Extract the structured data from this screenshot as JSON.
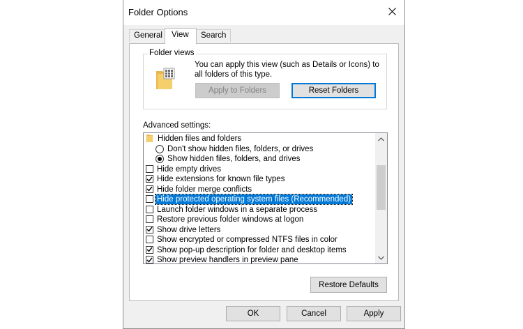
{
  "window": {
    "title": "Folder Options"
  },
  "tabs": [
    {
      "label": "General",
      "active": false
    },
    {
      "label": "View",
      "active": true
    },
    {
      "label": "Search",
      "active": false
    }
  ],
  "folder_views": {
    "legend": "Folder views",
    "description": "You can apply this view (such as Details or Icons) to all folders of this type.",
    "apply_button": "Apply to Folders",
    "reset_button": "Reset Folders"
  },
  "advanced": {
    "label": "Advanced settings:",
    "items": [
      {
        "type": "folder",
        "label": "Hidden files and folders"
      },
      {
        "type": "radio",
        "checked": false,
        "label": "Don't show hidden files, folders, or drives"
      },
      {
        "type": "radio",
        "checked": true,
        "label": "Show hidden files, folders, and drives"
      },
      {
        "type": "checkbox",
        "checked": false,
        "label": "Hide empty drives"
      },
      {
        "type": "checkbox",
        "checked": true,
        "label": "Hide extensions for known file types"
      },
      {
        "type": "checkbox",
        "checked": true,
        "label": "Hide folder merge conflicts"
      },
      {
        "type": "checkbox",
        "checked": false,
        "selected": true,
        "label": "Hide protected operating system files (Recommended)"
      },
      {
        "type": "checkbox",
        "checked": false,
        "label": "Launch folder windows in a separate process"
      },
      {
        "type": "checkbox",
        "checked": false,
        "label": "Restore previous folder windows at logon"
      },
      {
        "type": "checkbox",
        "checked": true,
        "label": "Show drive letters"
      },
      {
        "type": "checkbox",
        "checked": false,
        "label": "Show encrypted or compressed NTFS files in color"
      },
      {
        "type": "checkbox",
        "checked": true,
        "label": "Show pop-up description for folder and desktop items"
      },
      {
        "type": "checkbox",
        "checked": true,
        "label": "Show preview handlers in preview pane"
      },
      {
        "type": "checkbox",
        "checked": true,
        "label": ""
      }
    ],
    "restore_button": "Restore Defaults"
  },
  "footer": {
    "ok": "OK",
    "cancel": "Cancel",
    "apply": "Apply"
  },
  "colors": {
    "selection": "#0078d7",
    "dialog_bg": "#f0f0f0",
    "focus_border": "#0078d7"
  },
  "icons": {
    "close": "close-icon",
    "folder_views": "folder-views-icon",
    "tree_folder": "folder-icon",
    "check": "checkmark-icon"
  }
}
